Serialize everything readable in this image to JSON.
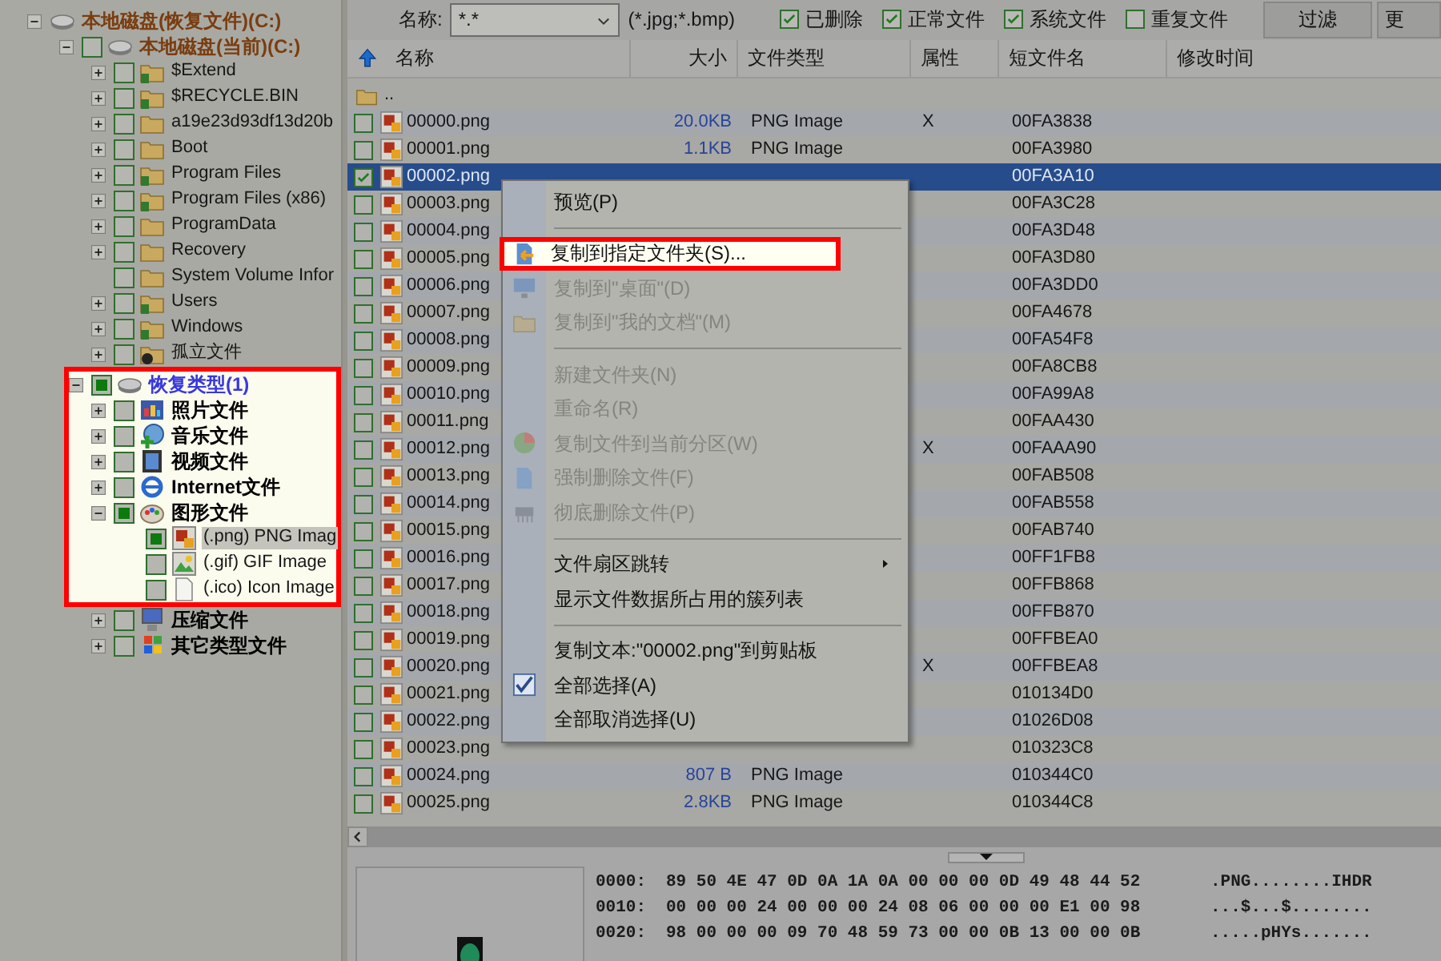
{
  "toolbar": {
    "name_label": "名称:",
    "pattern": "*.*",
    "pattern_hint": "(*.jpg;*.bmp)",
    "filters": [
      {
        "label": "已删除",
        "checked": true
      },
      {
        "label": "正常文件",
        "checked": true
      },
      {
        "label": "系统文件",
        "checked": true
      },
      {
        "label": "重复文件",
        "checked": false
      }
    ],
    "buttons": [
      "过滤",
      "更"
    ]
  },
  "tree": [
    {
      "label": "本地磁盘(恢复文件)(C:)",
      "kind": "drive",
      "expanded": true,
      "selected": false,
      "children": [
        {
          "label": "本地磁盘(当前)(C:)",
          "kind": "drive",
          "expanded": true,
          "checked": false,
          "selected": false,
          "children": [
            {
              "label": "$Extend",
              "kind": "trash-folder",
              "expanded": false,
              "checked": false,
              "selected": false
            },
            {
              "label": "$RECYCLE.BIN",
              "kind": "trash-folder",
              "expanded": false,
              "checked": false,
              "selected": false
            },
            {
              "label": "a19e23d93df13d20b",
              "kind": "folder",
              "expanded": false,
              "checked": false,
              "selected": false
            },
            {
              "label": "Boot",
              "kind": "folder",
              "expanded": false,
              "checked": false,
              "selected": false
            },
            {
              "label": "Program Files",
              "kind": "trash-folder",
              "expanded": false,
              "checked": false,
              "selected": false
            },
            {
              "label": "Program Files (x86)",
              "kind": "trash-folder",
              "expanded": false,
              "checked": false,
              "selected": false
            },
            {
              "label": "ProgramData",
              "kind": "folder",
              "expanded": false,
              "checked": false,
              "selected": false
            },
            {
              "label": "Recovery",
              "kind": "folder",
              "expanded": false,
              "checked": false,
              "selected": false
            },
            {
              "label": "System Volume Infor",
              "kind": "folder",
              "checked": false,
              "selected": false
            },
            {
              "label": "Users",
              "kind": "trash-folder",
              "expanded": false,
              "checked": false,
              "selected": false
            },
            {
              "label": "Windows",
              "kind": "trash-folder",
              "expanded": false,
              "checked": false,
              "selected": false
            },
            {
              "label": "孤立文件",
              "kind": "orphan",
              "expanded": false,
              "checked": false,
              "selected": false
            }
          ]
        },
        {
          "label": "恢复类型(1)",
          "kind": "recovery",
          "expanded": true,
          "checked": true,
          "selected": false,
          "highlighted": true,
          "children": [
            {
              "label": "照片文件",
              "kind": "photo",
              "expanded": false,
              "checked": false,
              "selected": false,
              "highlighted": true
            },
            {
              "label": "音乐文件",
              "kind": "music",
              "expanded": false,
              "checked": false,
              "selected": false,
              "highlighted": true
            },
            {
              "label": "视频文件",
              "kind": "video",
              "expanded": false,
              "checked": false,
              "selected": false,
              "highlighted": true
            },
            {
              "label": "Internet文件",
              "kind": "web",
              "expanded": false,
              "checked": false,
              "selected": false,
              "highlighted": true
            },
            {
              "label": "图形文件",
              "kind": "graphic",
              "expanded": true,
              "checked": true,
              "selected": false,
              "highlighted": true,
              "children": [
                {
                  "label": "(.png) PNG Imag",
                  "kind": "png",
                  "checked": true,
                  "selected": true,
                  "highlighted": true
                },
                {
                  "label": "(.gif) GIF Image",
                  "kind": "gif",
                  "checked": false,
                  "selected": false,
                  "highlighted": true
                },
                {
                  "label": "(.ico) Icon Image",
                  "kind": "ico",
                  "checked": false,
                  "selected": false,
                  "highlighted": true
                }
              ]
            },
            {
              "label": "压缩文件",
              "kind": "archive",
              "expanded": false,
              "checked": false,
              "selected": false
            },
            {
              "label": "其它类型文件",
              "kind": "other",
              "expanded": false,
              "checked": false,
              "selected": false
            }
          ]
        }
      ]
    }
  ],
  "file_list": {
    "columns": [
      "名称",
      "大小",
      "文件类型",
      "属性",
      "短文件名",
      "修改时间"
    ],
    "parent_row": "..",
    "rows": [
      {
        "name": "00000.png",
        "size": "20.0KB",
        "type": "PNG Image",
        "attr": "X",
        "short": "00FA3838",
        "checked": false,
        "selected": false
      },
      {
        "name": "00001.png",
        "size": "1.1KB",
        "type": "PNG Image",
        "short": "00FA3980",
        "checked": false,
        "selected": false
      },
      {
        "name": "00002.png",
        "short": "00FA3A10",
        "checked": true,
        "selected": true
      },
      {
        "name": "00003.png",
        "short": "00FA3C28",
        "checked": false,
        "selected": false
      },
      {
        "name": "00004.png",
        "short": "00FA3D48",
        "checked": false,
        "selected": false
      },
      {
        "name": "00005.png",
        "short": "00FA3D80",
        "checked": false,
        "selected": false
      },
      {
        "name": "00006.png",
        "short": "00FA3DD0",
        "checked": false,
        "selected": false
      },
      {
        "name": "00007.png",
        "short": "00FA4678",
        "checked": false,
        "selected": false
      },
      {
        "name": "00008.png",
        "short": "00FA54F8",
        "checked": false,
        "selected": false
      },
      {
        "name": "00009.png",
        "short": "00FA8CB8",
        "checked": false,
        "selected": false
      },
      {
        "name": "00010.png",
        "short": "00FA99A8",
        "checked": false,
        "selected": false
      },
      {
        "name": "00011.png",
        "short": "00FAA430",
        "checked": false,
        "selected": false
      },
      {
        "name": "00012.png",
        "attr": "X",
        "short": "00FAAA90",
        "checked": false,
        "selected": false
      },
      {
        "name": "00013.png",
        "short": "00FAB508",
        "checked": false,
        "selected": false
      },
      {
        "name": "00014.png",
        "short": "00FAB558",
        "checked": false,
        "selected": false
      },
      {
        "name": "00015.png",
        "short": "00FAB740",
        "checked": false,
        "selected": false
      },
      {
        "name": "00016.png",
        "short": "00FF1FB8",
        "checked": false,
        "selected": false
      },
      {
        "name": "00017.png",
        "short": "00FFB868",
        "checked": false,
        "selected": false
      },
      {
        "name": "00018.png",
        "short": "00FFB870",
        "checked": false,
        "selected": false
      },
      {
        "name": "00019.png",
        "short": "00FFBEA0",
        "checked": false,
        "selected": false
      },
      {
        "name": "00020.png",
        "attr": "X",
        "short": "00FFBEA8",
        "checked": false,
        "selected": false
      },
      {
        "name": "00021.png",
        "short": "010134D0",
        "checked": false,
        "selected": false
      },
      {
        "name": "00022.png",
        "short": "01026D08",
        "checked": false,
        "selected": false
      },
      {
        "name": "00023.png",
        "short": "010323C8",
        "checked": false,
        "selected": false
      },
      {
        "name": "00024.png",
        "size": "807 B",
        "type": "PNG Image",
        "short": "010344C0",
        "checked": false,
        "selected": false
      },
      {
        "name": "00025.png",
        "size": "2.8KB",
        "type": "PNG Image",
        "short": "010344C8",
        "checked": false,
        "selected": false
      }
    ]
  },
  "context_menu": {
    "items": [
      {
        "kind": "item",
        "label": "预览(P)",
        "disabled": false
      },
      {
        "kind": "separator"
      },
      {
        "kind": "item",
        "label": "复制到指定文件夹(S)...",
        "disabled": false,
        "highlighted": true
      },
      {
        "kind": "item",
        "label": "复制到\"桌面\"(D)",
        "disabled": true
      },
      {
        "kind": "item",
        "label": "复制到\"我的文档\"(M)",
        "disabled": true
      },
      {
        "kind": "separator"
      },
      {
        "kind": "item",
        "label": "新建文件夹(N)",
        "disabled": true
      },
      {
        "kind": "item",
        "label": "重命名(R)",
        "disabled": true
      },
      {
        "kind": "item",
        "label": "复制文件到当前分区(W)",
        "disabled": true
      },
      {
        "kind": "item",
        "label": "强制删除文件(F)",
        "disabled": true
      },
      {
        "kind": "item",
        "label": "彻底删除文件(P)",
        "disabled": true
      },
      {
        "kind": "separator"
      },
      {
        "kind": "item",
        "label": "文件扇区跳转",
        "disabled": false,
        "submenu": true
      },
      {
        "kind": "item",
        "label": "显示文件数据所占用的簇列表",
        "disabled": false
      },
      {
        "kind": "separator"
      },
      {
        "kind": "item",
        "label": "复制文本:\"00002.png\"到剪贴板",
        "disabled": false
      },
      {
        "kind": "item",
        "label": "全部选择(A)",
        "disabled": false
      },
      {
        "kind": "item",
        "label": "全部取消选择(U)",
        "disabled": false
      }
    ]
  },
  "hex_view": {
    "lines": [
      {
        "offset": "0000:",
        "bytes": "89 50 4E 47 0D 0A 1A 0A 00 00 00 0D 49 48 44 52",
        "ascii": ".PNG........IHDR"
      },
      {
        "offset": "0010:",
        "bytes": "00 00 00 24 00 00 00 24 08 06 00 00 00 E1 00 98",
        "ascii": "...$...$........"
      },
      {
        "offset": "0020:",
        "bytes": "98 00 00 00 09 70 48 59 73 00 00 0B 13 00 00 0B",
        "ascii": ".....pHYs......."
      }
    ]
  }
}
